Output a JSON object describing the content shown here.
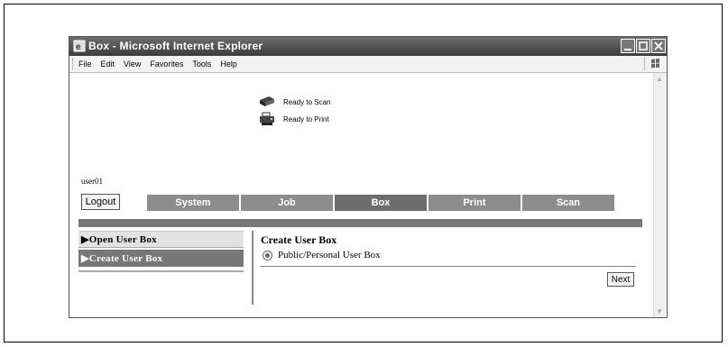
{
  "window": {
    "title": "Box - Microsoft Internet Explorer"
  },
  "menubar": {
    "items": [
      "File",
      "Edit",
      "View",
      "Favorites",
      "Tools",
      "Help"
    ]
  },
  "status": {
    "scan": "Ready to Scan",
    "print": "Ready to Print"
  },
  "user": {
    "name": "user01"
  },
  "toolbar": {
    "logout_label": "Logout",
    "tabs": [
      "System",
      "Job",
      "Box",
      "Print",
      "Scan"
    ],
    "active_tab": "Box"
  },
  "left_menu": {
    "items": [
      "▶Open User Box",
      "▶Create User Box"
    ],
    "selected": "Create User Box"
  },
  "panel": {
    "title": "Create User Box",
    "option_label": "Public/Personal User Box",
    "next_label": "Next"
  }
}
